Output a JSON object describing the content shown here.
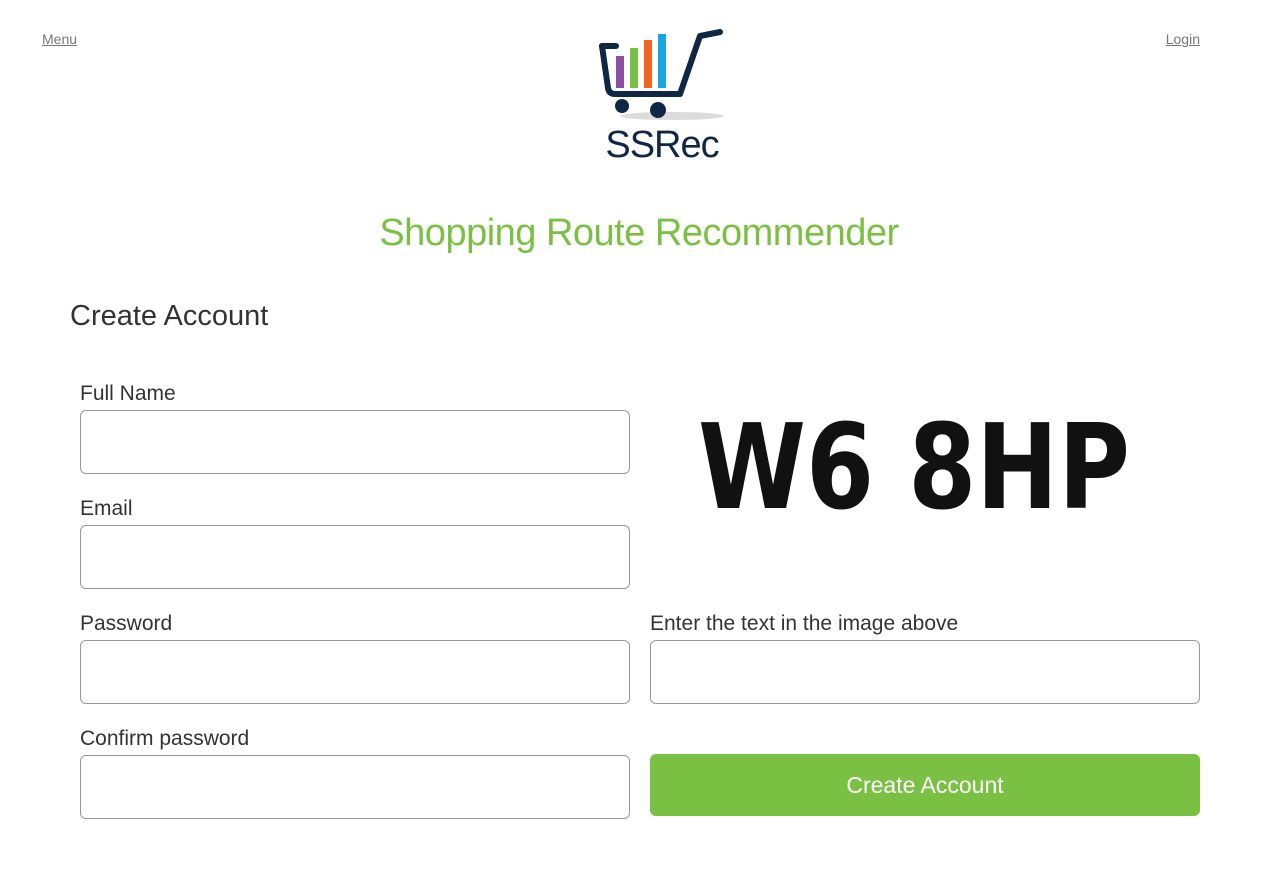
{
  "header": {
    "menu_label": "Menu",
    "login_label": "Login",
    "logo_text": "SSRec"
  },
  "subtitle": "Shopping Route Recommender",
  "form": {
    "title": "Create Account",
    "full_name_label": "Full Name",
    "email_label": "Email",
    "password_label": "Password",
    "confirm_password_label": "Confirm password",
    "captcha_label": "Enter the text in the image above",
    "captcha_text": "W6 8HP",
    "submit_label": "Create Account"
  },
  "colors": {
    "accent": "#7ac143",
    "logo_navy": "#0f2744",
    "bar_purple": "#8e4fa3",
    "bar_green": "#7ac143",
    "bar_orange": "#f26522",
    "bar_blue": "#1aa6e0"
  },
  "icons": {
    "logo": "shopping-cart-icon"
  }
}
